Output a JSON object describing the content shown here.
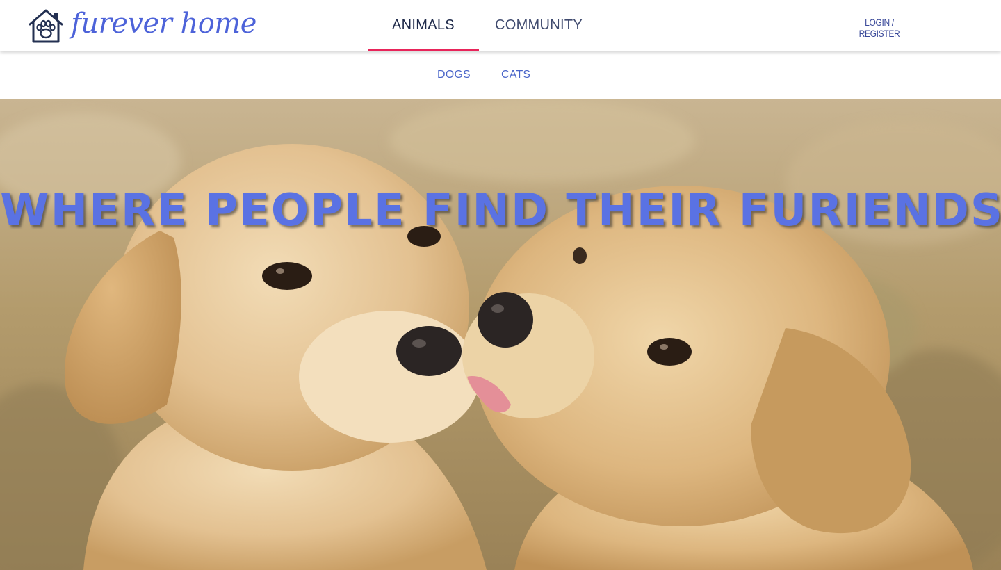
{
  "brand": {
    "name": "furever home",
    "icon": "house-paw-icon"
  },
  "main_nav": [
    {
      "label": "ANIMALS",
      "active": true
    },
    {
      "label": "COMMUNITY",
      "active": false
    }
  ],
  "auth": {
    "label": "LOGIN / REGISTER"
  },
  "sub_nav": [
    {
      "label": "DOGS"
    },
    {
      "label": "CATS"
    }
  ],
  "hero": {
    "headline": "WHERE PEOPLE FIND THEIR FURIENDS",
    "image": "two-puppies-kissing-photo"
  },
  "colors": {
    "brand": "#4d63d9",
    "active_tab_underline": "#e8245a",
    "headline": "#5a72e3",
    "nav_link": "#4a65c9"
  }
}
